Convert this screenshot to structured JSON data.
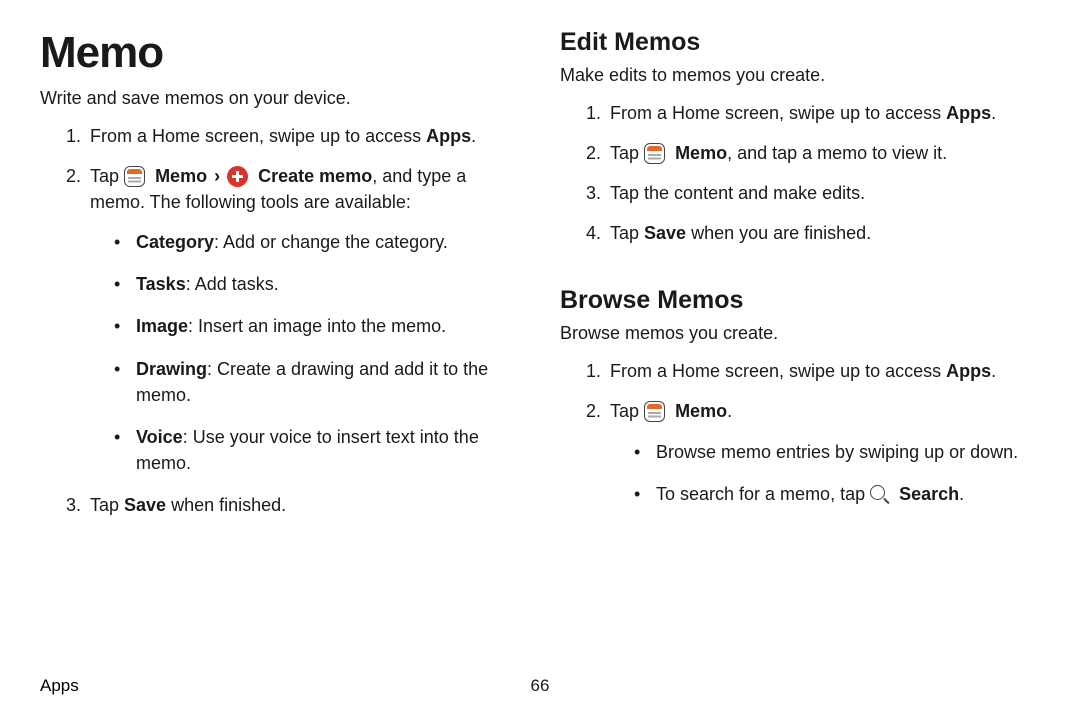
{
  "title": "Memo",
  "intro": "Write and save memos on your device.",
  "left": {
    "step1_prefix": "From a Home screen, swipe up to access ",
    "step1_bold": "Apps",
    "step1_suffix": ".",
    "step2_prefix": "Tap ",
    "step2_memo": "Memo",
    "step2_chevron": "›",
    "step2_create": "Create memo",
    "step2_suffix": ", and type a memo. The following tools are available:",
    "tools": {
      "category_b": "Category",
      "category": ": Add or change the category.",
      "tasks_b": "Tasks",
      "tasks": ": Add tasks.",
      "image_b": "Image",
      "image": ": Insert an image into the memo.",
      "drawing_b": "Drawing",
      "drawing": ": Create a drawing and add it to the memo.",
      "voice_b": "Voice",
      "voice": ": Use your voice to insert text into the memo."
    },
    "step3_prefix": "Tap ",
    "step3_bold": "Save",
    "step3_suffix": " when finished."
  },
  "edit": {
    "title": "Edit Memos",
    "intro": "Make edits to memos you create.",
    "s1_pre": "From a Home screen, swipe up to access ",
    "s1_bold": "Apps",
    "s1_suf": ".",
    "s2_pre": "Tap ",
    "s2_memo": "Memo",
    "s2_suf": ", and tap a memo to view it.",
    "s3": "Tap the content and make edits.",
    "s4_pre": "Tap ",
    "s4_bold": "Save",
    "s4_suf": " when you are finished."
  },
  "browse": {
    "title": "Browse Memos",
    "intro": "Browse memos you create.",
    "s1_pre": "From a Home screen, swipe up to access ",
    "s1_bold": "Apps",
    "s1_suf": ".",
    "s2_pre": "Tap ",
    "s2_memo": "Memo",
    "s2_suf": ".",
    "b1": "Browse memo entries by swiping up or down.",
    "b2_pre": "To search for a memo, tap ",
    "b2_bold": "Search",
    "b2_suf": "."
  },
  "footer": {
    "section": "Apps",
    "page": "66"
  }
}
